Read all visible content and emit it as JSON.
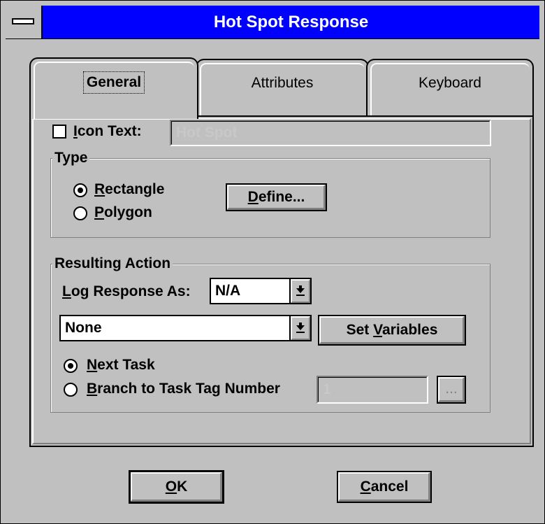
{
  "window": {
    "title": "Hot Spot Response"
  },
  "tabs": [
    {
      "label": "General"
    },
    {
      "label": "Attributes"
    },
    {
      "label": "Keyboard"
    }
  ],
  "icon_text": {
    "checkbox_label_mnemonic": "I",
    "checkbox_label_rest": "con Text:",
    "checked": false,
    "value": "Hot Spot"
  },
  "type_group": {
    "label": "Type",
    "options": [
      {
        "mnemonic": "R",
        "rest": "ectangle",
        "selected": true
      },
      {
        "mnemonic": "P",
        "rest": "olygon",
        "selected": false
      }
    ],
    "define_button": {
      "mnemonic": "D",
      "rest": "efine..."
    }
  },
  "action_group": {
    "label": "Resulting Action",
    "log_label_mnemonic": "L",
    "log_label_rest": "og Response As:",
    "log_value": "N/A",
    "action_value": "None",
    "set_variables_button": {
      "before": "Set ",
      "mnemonic": "V",
      "rest": "ariables"
    },
    "options": [
      {
        "mnemonic": "N",
        "rest": "ext Task",
        "selected": true
      },
      {
        "mnemonic": "B",
        "rest": "ranch to Task Tag Number",
        "selected": false
      }
    ],
    "task_tag_value": "1",
    "browse_button": "..."
  },
  "footer": {
    "ok_mnemonic": "O",
    "ok_rest": "K",
    "cancel_mnemonic": "C",
    "cancel_rest": "ancel"
  }
}
